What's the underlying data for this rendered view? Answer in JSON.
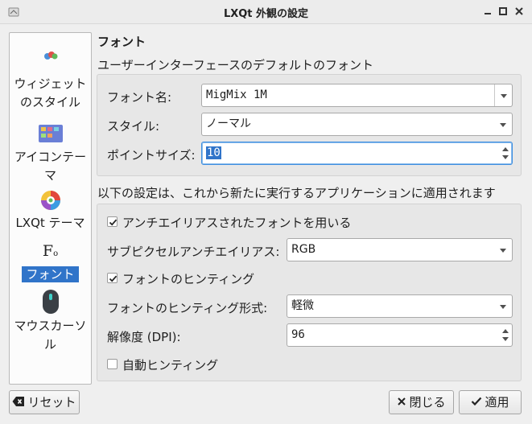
{
  "window": {
    "title": "LXQt 外観の設定"
  },
  "sidebar": {
    "items": [
      {
        "label": "ウィジェットのスタイル",
        "icon": "widget-style-icon"
      },
      {
        "label": "アイコンテーマ",
        "icon": "icon-theme-icon"
      },
      {
        "label": "LXQt テーマ",
        "icon": "lxqt-theme-icon"
      },
      {
        "label": "フォント",
        "icon": "font-icon",
        "active": true
      },
      {
        "label": "マウスカーソル",
        "icon": "mouse-cursor-icon"
      }
    ]
  },
  "main": {
    "heading": "フォント",
    "default_font_group": "ユーザーインターフェースのデフォルトのフォント",
    "font_name_label": "フォント名:",
    "font_name_value": "MigMix 1M",
    "style_label": "スタイル:",
    "style_value": "ノーマル",
    "point_size_label": "ポイントサイズ:",
    "point_size_value": "10",
    "applies_note": "以下の設定は、これから新たに実行するアプリケーションに適用されます",
    "antialias_label": "アンチエイリアスされたフォントを用いる",
    "antialias_checked": true,
    "subpixel_label": "サブピクセルアンチエイリアス:",
    "subpixel_value": "RGB",
    "hinting_label": "フォントのヒンティング",
    "hinting_checked": true,
    "hinting_style_label": "フォントのヒンティング形式:",
    "hinting_style_value": "軽微",
    "dpi_label": "解像度 (DPI):",
    "dpi_value": "96",
    "autohint_label": "自動ヒンティング",
    "autohint_checked": false
  },
  "footer": {
    "reset_label": "リセット",
    "close_label": "閉じる",
    "apply_label": "適用"
  },
  "colors": {
    "accent": "#3074c9"
  }
}
